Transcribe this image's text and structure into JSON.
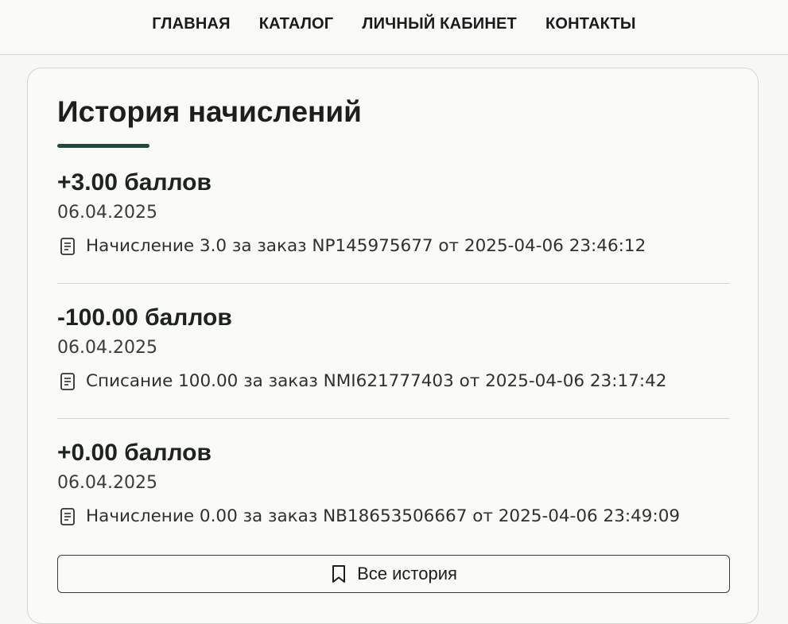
{
  "nav": {
    "items": [
      {
        "label": "ГЛАВНАЯ"
      },
      {
        "label": "КАТАЛОГ"
      },
      {
        "label": "ЛИЧНЫЙ КАБИНЕТ"
      },
      {
        "label": "КОНТАКТЫ"
      }
    ]
  },
  "history": {
    "title": "История начислений",
    "entries": [
      {
        "points": "+3.00 баллов",
        "date": "06.04.2025",
        "icon": "document-icon",
        "description": "Начисление 3.0 за заказ NP145975677 от 2025-04-06 23:46:12"
      },
      {
        "points": "-100.00 баллов",
        "date": "06.04.2025",
        "icon": "document-icon",
        "description": "Списание 100.00 за заказ NMI621777403 от 2025-04-06 23:17:42"
      },
      {
        "points": "+0.00 баллов",
        "date": "06.04.2025",
        "icon": "document-icon",
        "description": "Начисление 0.00 за заказ NB18653506667 от 2025-04-06 23:49:09"
      }
    ],
    "all_button": {
      "label": "Все история",
      "icon": "bookmark-icon"
    }
  },
  "colors": {
    "accent": "#1e4b3f",
    "background": "#f7f7f4",
    "card": "#fafaf6"
  }
}
